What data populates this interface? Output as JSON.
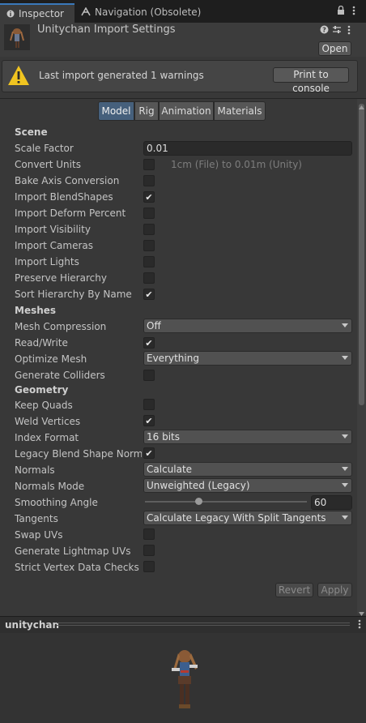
{
  "tabs": {
    "inspector": "Inspector",
    "navigation": "Navigation (Obsolete)"
  },
  "header": {
    "title": "Unitychan Import Settings",
    "open_label": "Open"
  },
  "warning": {
    "message": "Last import generated 1 warnings",
    "print_label": "Print to console"
  },
  "segments": {
    "model": "Model",
    "rig": "Rig",
    "animation": "Animation",
    "materials": "Materials"
  },
  "scene": {
    "heading": "Scene",
    "scale_factor_label": "Scale Factor",
    "scale_factor_value": "0.01",
    "convert_units_label": "Convert Units",
    "convert_units_note": "1cm (File) to 0.01m (Unity)",
    "bake_axis_label": "Bake Axis Conversion",
    "import_blendshapes_label": "Import BlendShapes",
    "import_deform_label": "Import Deform Percent",
    "import_visibility_label": "Import Visibility",
    "import_cameras_label": "Import Cameras",
    "import_lights_label": "Import Lights",
    "preserve_hierarchy_label": "Preserve Hierarchy",
    "sort_hierarchy_label": "Sort Hierarchy By Name",
    "convert_units_checked": false,
    "bake_axis_checked": false,
    "import_blendshapes_checked": true,
    "import_deform_checked": false,
    "import_visibility_checked": false,
    "import_cameras_checked": false,
    "import_lights_checked": false,
    "preserve_hierarchy_checked": false,
    "sort_hierarchy_checked": true
  },
  "meshes": {
    "heading": "Meshes",
    "mesh_compression_label": "Mesh Compression",
    "mesh_compression_value": "Off",
    "read_write_label": "Read/Write",
    "read_write_checked": true,
    "optimize_mesh_label": "Optimize Mesh",
    "optimize_mesh_value": "Everything",
    "generate_colliders_label": "Generate Colliders",
    "generate_colliders_checked": false
  },
  "geometry": {
    "heading": "Geometry",
    "keep_quads_label": "Keep Quads",
    "keep_quads_checked": false,
    "weld_vertices_label": "Weld Vertices",
    "weld_vertices_checked": true,
    "index_format_label": "Index Format",
    "index_format_value": "16 bits",
    "legacy_blend_label": "Legacy Blend Shape Norma",
    "legacy_blend_checked": true,
    "normals_label": "Normals",
    "normals_value": "Calculate",
    "normals_mode_label": "Normals Mode",
    "normals_mode_value": "Unweighted (Legacy)",
    "smoothing_angle_label": "Smoothing Angle",
    "smoothing_angle_value": "60",
    "smoothing_angle_fraction": 0.333,
    "tangents_label": "Tangents",
    "tangents_value": "Calculate Legacy With Split Tangents",
    "swap_uvs_label": "Swap UVs",
    "swap_uvs_checked": false,
    "generate_lightmap_label": "Generate Lightmap UVs",
    "generate_lightmap_checked": false,
    "strict_vertex_label": "Strict Vertex Data Checks",
    "strict_vertex_checked": false
  },
  "footer": {
    "revert_label": "Revert",
    "apply_label": "Apply"
  },
  "preview": {
    "title": "unitychan"
  },
  "colors": {
    "accent": "#3a79bb",
    "selected_tab": "#46607c",
    "warning": "#f0c420"
  }
}
